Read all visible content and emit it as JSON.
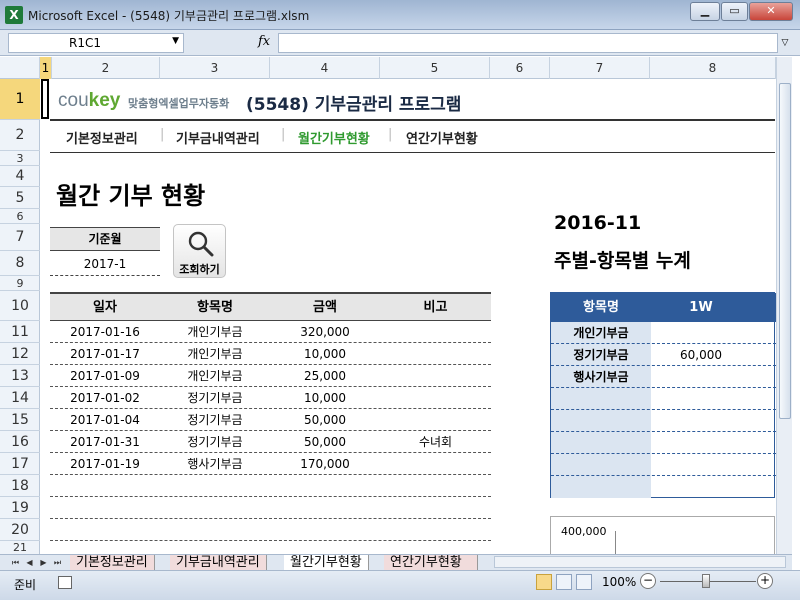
{
  "window": {
    "title": "Microsoft Excel - (5548) 기부금관리 프로그램.xlsm",
    "app_icon": "X",
    "minimize": "▁",
    "restore": "▭",
    "close": "✕"
  },
  "formula_bar": {
    "name_box": "R1C1",
    "fx": "fx",
    "formula": ""
  },
  "columns": [
    "1",
    "2",
    "3",
    "4",
    "5",
    "6",
    "7",
    "8"
  ],
  "rows": [
    "1",
    "2",
    "3",
    "4",
    "5",
    "6",
    "7",
    "8",
    "9",
    "10",
    "11",
    "12",
    "13",
    "14",
    "15",
    "16",
    "17",
    "18",
    "19",
    "20",
    "21"
  ],
  "header": {
    "logo_main": "cou",
    "logo_key": "key",
    "logo_sub": "맞춤형엑셀업무자동화",
    "app_title": "(5548) 기부금관리 프로그램"
  },
  "nav": {
    "items": [
      "기본정보관리",
      "기부금내역관리",
      "월간기부현황",
      "연간기부현황"
    ],
    "separator": "|"
  },
  "page_heading": "월간 기부 현황",
  "filter": {
    "label": "기준월",
    "value": "2017-1",
    "search_label": "조회하기"
  },
  "main_table": {
    "headers": [
      "일자",
      "항목명",
      "금액",
      "비고"
    ],
    "rows": [
      {
        "date": "2017-01-16",
        "item": "개인기부금",
        "amount": "320,000",
        "note": ""
      },
      {
        "date": "2017-01-17",
        "item": "개인기부금",
        "amount": "10,000",
        "note": ""
      },
      {
        "date": "2017-01-09",
        "item": "개인기부금",
        "amount": "25,000",
        "note": ""
      },
      {
        "date": "2017-01-02",
        "item": "정기기부금",
        "amount": "10,000",
        "note": ""
      },
      {
        "date": "2017-01-04",
        "item": "정기기부금",
        "amount": "50,000",
        "note": ""
      },
      {
        "date": "2017-01-31",
        "item": "정기기부금",
        "amount": "50,000",
        "note": "수녀회"
      },
      {
        "date": "2017-01-19",
        "item": "행사기부금",
        "amount": "170,000",
        "note": ""
      }
    ],
    "empty_rows": 3
  },
  "summary": {
    "month": "2016-11",
    "title": "주별-항목별 누계",
    "headers": [
      "항목명",
      "1W"
    ],
    "rows": [
      {
        "item": "개인기부금",
        "w1": ""
      },
      {
        "item": "정기기부금",
        "w1": "60,000"
      },
      {
        "item": "행사기부금",
        "w1": ""
      }
    ],
    "empty_rows": 5
  },
  "chart": {
    "tick_top": "400,000"
  },
  "sheet_tabs": {
    "nav": [
      "⏮",
      "◀",
      "▶",
      "⏭"
    ],
    "tabs": [
      "기본정보관리",
      "기부금내역관리",
      "월간기부현황",
      "연간기부현황"
    ],
    "active": 2
  },
  "status": {
    "ready": "준비",
    "zoom": "100%",
    "zoom_out": "−",
    "zoom_in": "+"
  }
}
